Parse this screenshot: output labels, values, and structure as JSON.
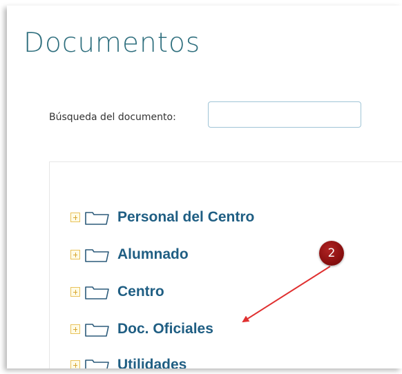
{
  "page": {
    "title": "Documentos"
  },
  "search": {
    "label": "Búsqueda del documento:",
    "value": ""
  },
  "tree": {
    "items": [
      {
        "label": "Personal del Centro"
      },
      {
        "label": "Alumnado"
      },
      {
        "label": "Centro"
      },
      {
        "label": "Doc. Oficiales"
      },
      {
        "label": "Utilidades"
      }
    ]
  },
  "annotation": {
    "step_number": "2"
  },
  "colors": {
    "title": "#2f6f7e",
    "tree_label": "#1f5e83",
    "folder_outline": "#2b5a7a",
    "expander_border": "#e9c25a",
    "annotation_badge": "#8a1010",
    "annotation_arrow": "#e03030"
  }
}
